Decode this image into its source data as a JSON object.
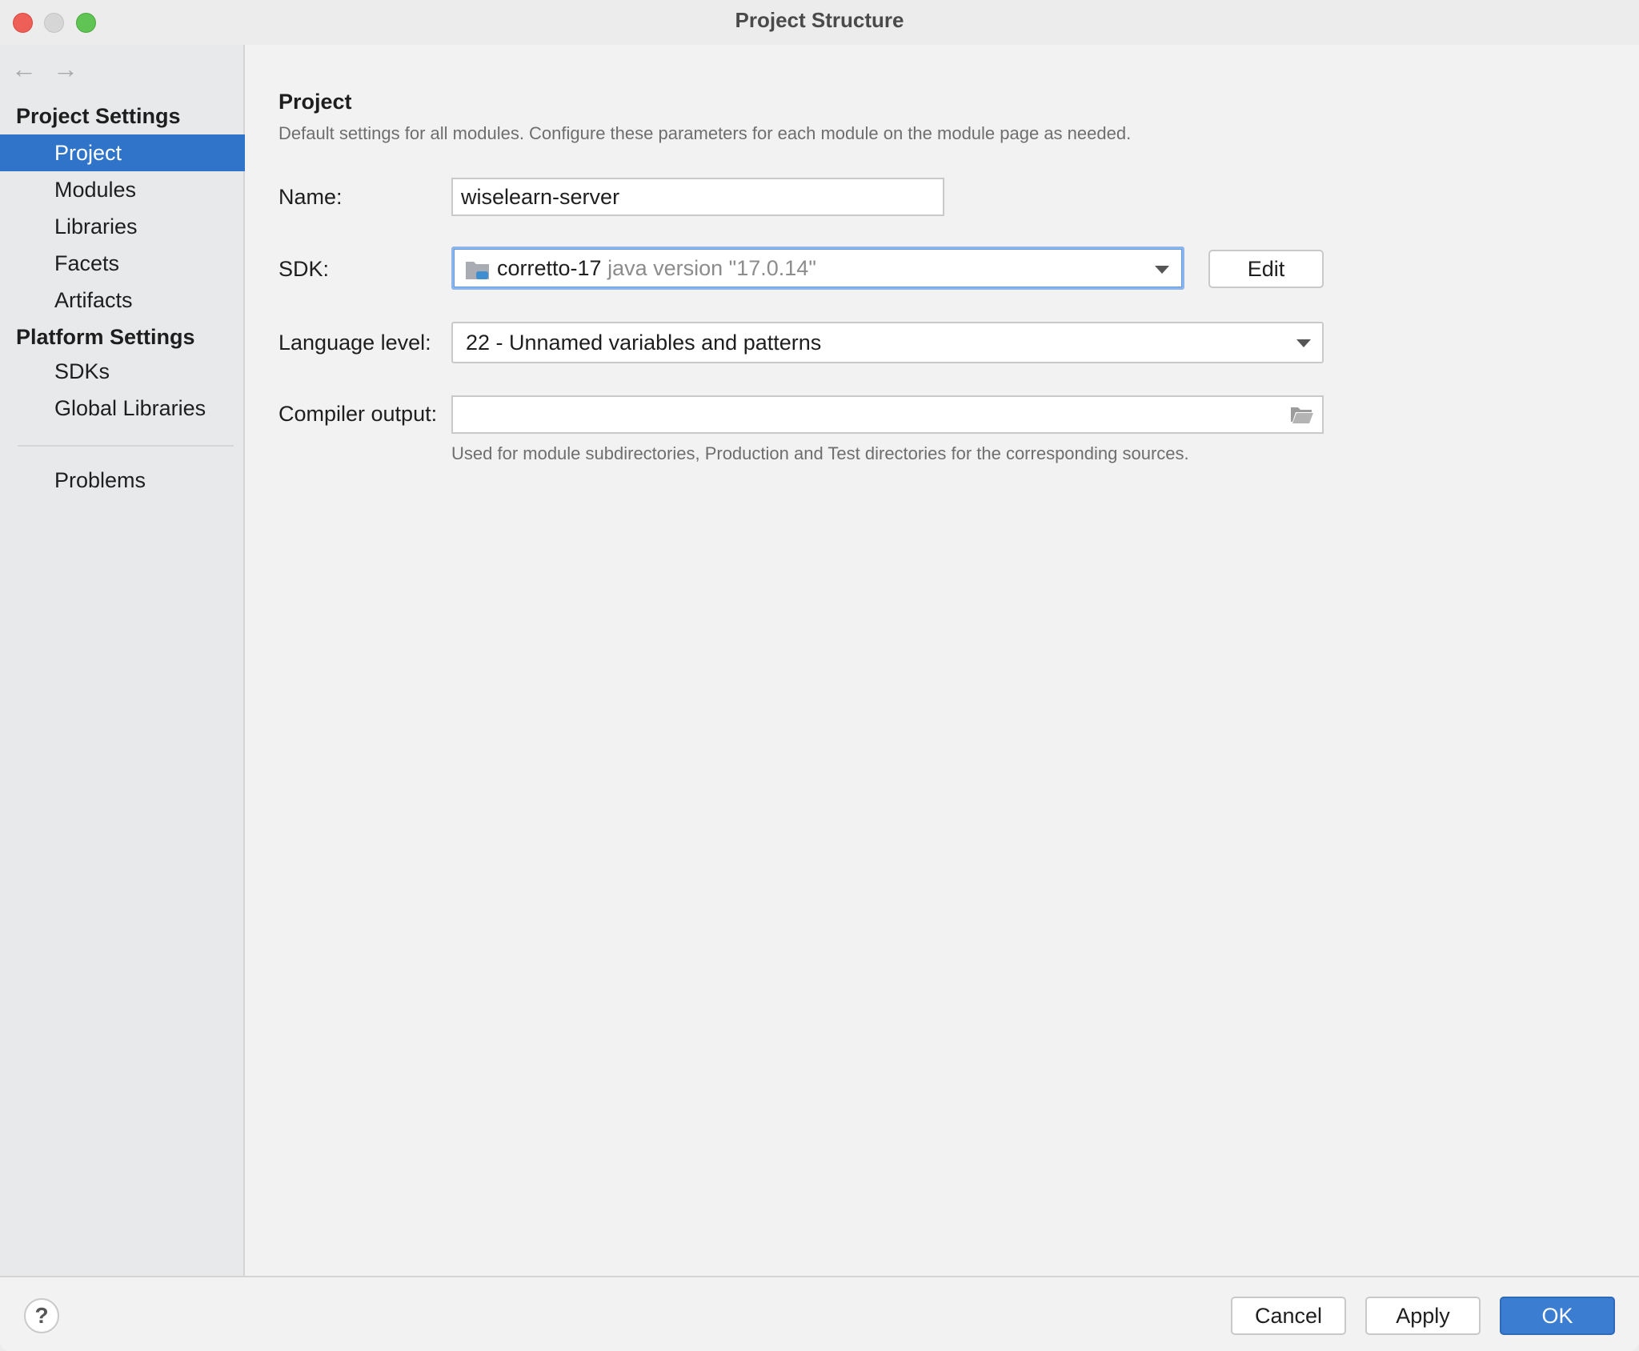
{
  "window": {
    "title": "Project Structure"
  },
  "nav": {
    "back_icon": "←",
    "forward_icon": "→"
  },
  "sidebar": {
    "project_settings_header": "Project Settings",
    "project_items": [
      {
        "label": "Project",
        "selected": true
      },
      {
        "label": "Modules"
      },
      {
        "label": "Libraries"
      },
      {
        "label": "Facets"
      },
      {
        "label": "Artifacts"
      }
    ],
    "platform_settings_header": "Platform Settings",
    "platform_items": [
      {
        "label": "SDKs"
      },
      {
        "label": "Global Libraries"
      }
    ],
    "problems_label": "Problems"
  },
  "main": {
    "title": "Project",
    "description": "Default settings for all modules. Configure these parameters for each module on the module page as needed.",
    "name_label": "Name:",
    "name_value": "wiselearn-server",
    "sdk_label": "SDK:",
    "sdk_name": "corretto-17",
    "sdk_version": "java version \"17.0.14\"",
    "sdk_edit_label": "Edit",
    "language_level_label": "Language level:",
    "language_level_value": "22 - Unnamed variables and patterns",
    "compiler_output_label": "Compiler output:",
    "compiler_output_value": "",
    "compiler_output_hint": "Used for module subdirectories, Production and Test directories for the corresponding sources."
  },
  "footer": {
    "help_label": "?",
    "cancel_label": "Cancel",
    "apply_label": "Apply",
    "ok_label": "OK"
  },
  "colors": {
    "selection": "#2f74c9",
    "primary_button": "#3a7dd1"
  }
}
